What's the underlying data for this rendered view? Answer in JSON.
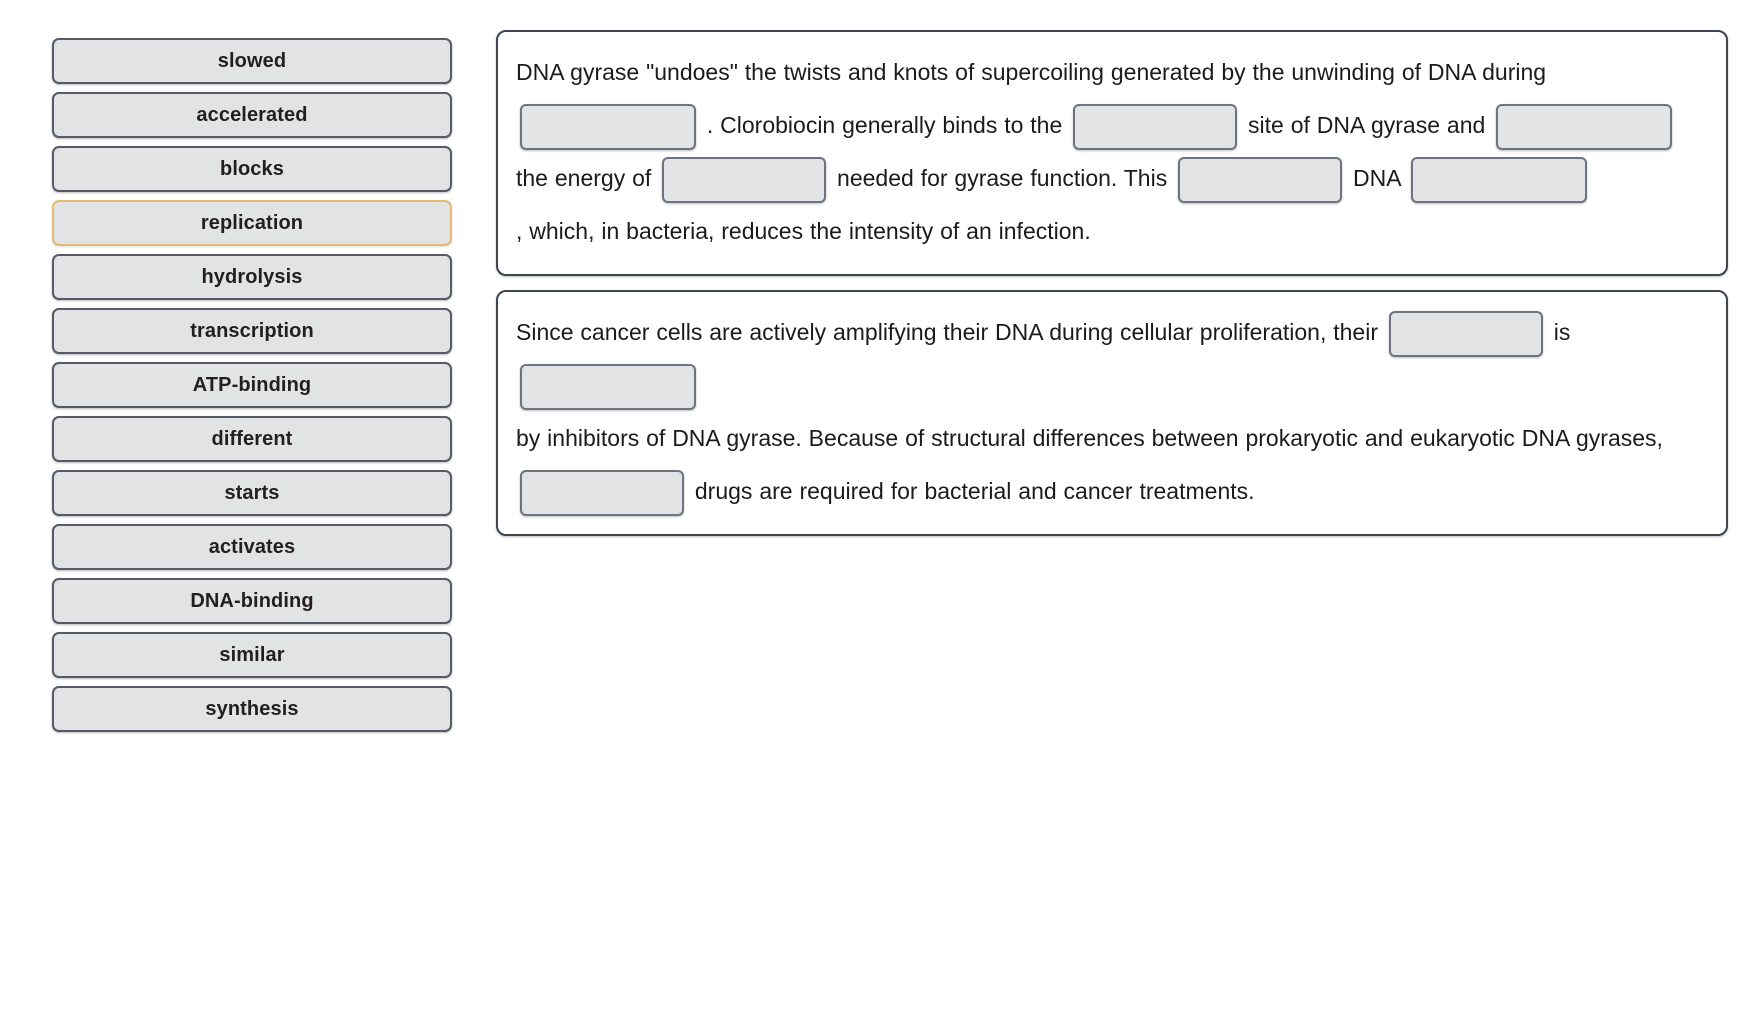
{
  "wordbank": {
    "name": "word-bank",
    "items": [
      {
        "label": "slowed",
        "selected": false
      },
      {
        "label": "accelerated",
        "selected": false
      },
      {
        "label": "blocks",
        "selected": false
      },
      {
        "label": "replication",
        "selected": true
      },
      {
        "label": "hydrolysis",
        "selected": false
      },
      {
        "label": "transcription",
        "selected": false
      },
      {
        "label": "ATP-binding",
        "selected": false
      },
      {
        "label": "different",
        "selected": false
      },
      {
        "label": "starts",
        "selected": false
      },
      {
        "label": "activates",
        "selected": false
      },
      {
        "label": "DNA-binding",
        "selected": false
      },
      {
        "label": "similar",
        "selected": false
      },
      {
        "label": "synthesis",
        "selected": false
      }
    ]
  },
  "passages": [
    {
      "id": "passage-1",
      "segments": [
        {
          "type": "text",
          "value": "DNA gyrase \"undoes\" the twists and knots of supercoiling generated by the unwinding of DNA during"
        },
        {
          "type": "blank",
          "value": "",
          "size": "w-lg"
        },
        {
          "type": "text",
          "value": ". Clorobiocin generally binds to the"
        },
        {
          "type": "blank",
          "value": "",
          "size": "w-md"
        },
        {
          "type": "text",
          "value": "site of DNA gyrase and"
        },
        {
          "type": "blank",
          "value": "",
          "size": "w-lg"
        },
        {
          "type": "text",
          "value": "the energy of"
        },
        {
          "type": "blank",
          "value": "",
          "size": "w-md"
        },
        {
          "type": "text",
          "value": "needed for gyrase function. This"
        },
        {
          "type": "blank",
          "value": "",
          "size": "w-md"
        },
        {
          "type": "text",
          "value": "DNA"
        },
        {
          "type": "blank",
          "value": "",
          "size": "w-lg"
        },
        {
          "type": "text",
          "value": ", which, in bacteria, reduces the intensity of an infection."
        }
      ]
    },
    {
      "id": "passage-2",
      "segments": [
        {
          "type": "text",
          "value": "Since cancer cells are actively amplifying their DNA during cellular proliferation, their"
        },
        {
          "type": "blank",
          "value": "",
          "size": "w-sm"
        },
        {
          "type": "text",
          "value": "is"
        },
        {
          "type": "blank",
          "value": "",
          "size": "w-lg"
        },
        {
          "type": "text",
          "value": "by inhibitors of DNA gyrase. Because of structural differences between prokaryotic and eukaryotic DNA gyrases,"
        },
        {
          "type": "blank",
          "value": "",
          "size": "w-md"
        },
        {
          "type": "text",
          "value": "drugs are required for bacterial and cancer treatments."
        }
      ]
    }
  ],
  "colors": {
    "chip_fill": "#e2e3e4",
    "chip_border": "#555a66",
    "chip_selected_border": "#e6b872",
    "panel_border": "#3c4550",
    "blank_border": "#6d7380",
    "text": "#1b1b1b",
    "page_bg": "#ffffff"
  }
}
